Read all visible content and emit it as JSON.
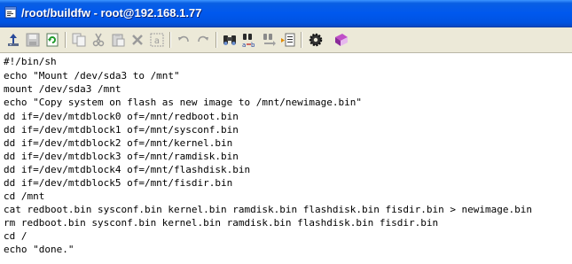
{
  "window": {
    "title": "/root/buildfw - root@192.168.1.77",
    "title_bar_color": "#0058ee",
    "app_icon": "terminal-document-icon"
  },
  "toolbar": {
    "buttons": [
      {
        "name": "upload-button",
        "icon": "upload-icon",
        "enabled": true
      },
      {
        "name": "save-button",
        "icon": "save-icon",
        "enabled": false
      },
      {
        "name": "refresh-button",
        "icon": "refresh-icon",
        "enabled": true
      },
      {
        "name": "copy-button",
        "icon": "copy-icon",
        "enabled": false
      },
      {
        "name": "cut-button",
        "icon": "cut-icon",
        "enabled": false
      },
      {
        "name": "paste-button",
        "icon": "paste-icon",
        "enabled": false
      },
      {
        "name": "delete-button",
        "icon": "delete-icon",
        "enabled": false
      },
      {
        "name": "select-all-button",
        "icon": "select-all-icon",
        "enabled": false
      },
      {
        "name": "undo-button",
        "icon": "undo-icon",
        "enabled": false
      },
      {
        "name": "redo-button",
        "icon": "redo-icon",
        "enabled": false
      },
      {
        "name": "find-button",
        "icon": "binoculars-icon",
        "enabled": true
      },
      {
        "name": "replace-button",
        "icon": "find-replace-icon",
        "enabled": true
      },
      {
        "name": "find-next-button",
        "icon": "find-next-icon",
        "enabled": false
      },
      {
        "name": "goto-line-button",
        "icon": "goto-document-icon",
        "enabled": true
      },
      {
        "name": "preferences-button",
        "icon": "gear-icon",
        "enabled": true
      },
      {
        "name": "help-button",
        "icon": "help-book-icon",
        "enabled": true
      }
    ]
  },
  "editor": {
    "lines": [
      "#!/bin/sh",
      "echo \"Mount /dev/sda3 to /mnt\"",
      "mount /dev/sda3 /mnt",
      "echo \"Copy system on flash as new image to /mnt/newimage.bin\"",
      "dd if=/dev/mtdblock0 of=/mnt/redboot.bin",
      "dd if=/dev/mtdblock1 of=/mnt/sysconf.bin",
      "dd if=/dev/mtdblock2 of=/mnt/kernel.bin",
      "dd if=/dev/mtdblock3 of=/mnt/ramdisk.bin",
      "dd if=/dev/mtdblock4 of=/mnt/flashdisk.bin",
      "dd if=/dev/mtdblock5 of=/mnt/fisdir.bin",
      "cd /mnt",
      "cat redboot.bin sysconf.bin kernel.bin ramdisk.bin flashdisk.bin fisdir.bin > newimage.bin",
      "rm redboot.bin sysconf.bin kernel.bin ramdisk.bin flashdisk.bin fisdir.bin",
      "cd /",
      "echo \"done.\""
    ]
  }
}
